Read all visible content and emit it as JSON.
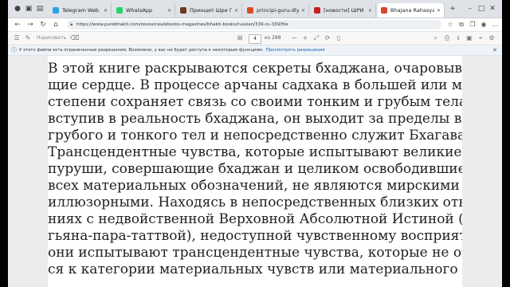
{
  "tabs": [
    {
      "title": "Telegram Web",
      "fav_color": "#2aa3e0"
    },
    {
      "title": "WhatsApp",
      "fav_color": "#25d366"
    },
    {
      "title": "Принцип Шри Гуру — Те...",
      "fav_color": "#6b3b1f"
    },
    {
      "title": "principi-guru-dlya-sajtu...",
      "fav_color": "#d94b2b"
    },
    {
      "title": "[новости] ШРИ НАВАДВ...",
      "fav_color": "#c5221f"
    },
    {
      "title": "Bhajana Rahasya.pdf",
      "fav_color": "#d8432f"
    }
  ],
  "address": {
    "url": "https://www.purebhakti.com/resources/ebooks-magazines/bhakti-books/russian/339-ru-339/file"
  },
  "pdf_toolbar": {
    "draw_label": "Нарисовать",
    "page_current": "4",
    "page_total": "из 288"
  },
  "infobar": {
    "message": "У этого файла есть ограниченные разрешения. Возможно, у вас не будет доступа к некоторым функциям.",
    "link": "Просмотреть разрешения"
  },
  "document": {
    "lines": [
      "В этой книге раскрываются секреты бхаджана, очаровываю-",
      "щие сердце. В процессе арчаны садхака в большей или меньшей",
      "степени сохраняет связь со своими тонким и грубым телами. Но,",
      "вступив в реальность бхаджана, он выходит за пределы влияния",
      "грубого и тонкого тел и непосредственно служит Бхагавану.",
      "Трансцендентные чувства, которые испытывают великие маха-",
      "пуруши, совершающие бхаджан и целиком освободившиеся от",
      "всех материальных обозначений, не являются мирскими или",
      "иллюзорными. Находясь в непосредственных близких отноше-",
      "ниях с недвойственной Верховной Абсолютной Истиной (адвая-",
      "гьяна-пара-таттвой), недоступной чувственному восприятию,",
      "они испытывают трансцендентные чувства, которые не относят-",
      "ся к категории материальных чувств или материального времени."
    ]
  }
}
